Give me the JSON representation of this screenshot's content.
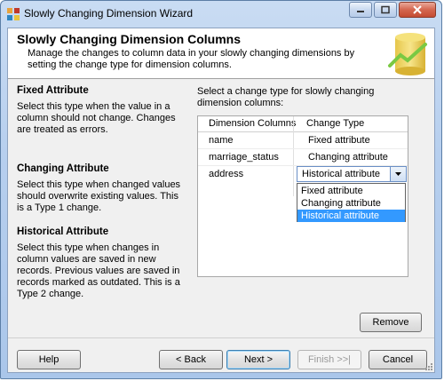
{
  "window": {
    "title": "Slowly Changing Dimension Wizard"
  },
  "header": {
    "title": "Slowly Changing Dimension Columns",
    "description": "Manage the changes to column data in your slowly changing dimensions by setting the change type for dimension columns."
  },
  "sections": [
    {
      "title": "Fixed Attribute",
      "text": "Select this type when the value in a column should not change. Changes are treated as errors."
    },
    {
      "title": "Changing Attribute",
      "text": "Select this type when changed values should overwrite existing values. This is a Type 1 change."
    },
    {
      "title": "Historical Attribute",
      "text": "Select this type when changes in column values are saved in new records. Previous values are saved in records marked as outdated. This is a Type 2 change."
    }
  ],
  "instruction": "Select a change type for slowly changing dimension columns:",
  "grid": {
    "headers": [
      "Dimension Columns",
      "Change Type"
    ],
    "rows": [
      {
        "column": "name",
        "type": "Fixed attribute"
      },
      {
        "column": "marriage_status",
        "type": "Changing attribute"
      },
      {
        "column": "address",
        "type": "Historical attribute"
      }
    ],
    "dropdown_options": [
      "Fixed attribute",
      "Changing attribute",
      "Historical attribute"
    ],
    "selected_option": "Historical attribute"
  },
  "buttons": {
    "remove": "Remove",
    "help": "Help",
    "back": "< Back",
    "next": "Next >",
    "finish": "Finish >>|",
    "cancel": "Cancel"
  },
  "colors": {
    "selection": "#3399ff",
    "title_bar": "#b7cfee",
    "close_button": "#c44b32"
  }
}
